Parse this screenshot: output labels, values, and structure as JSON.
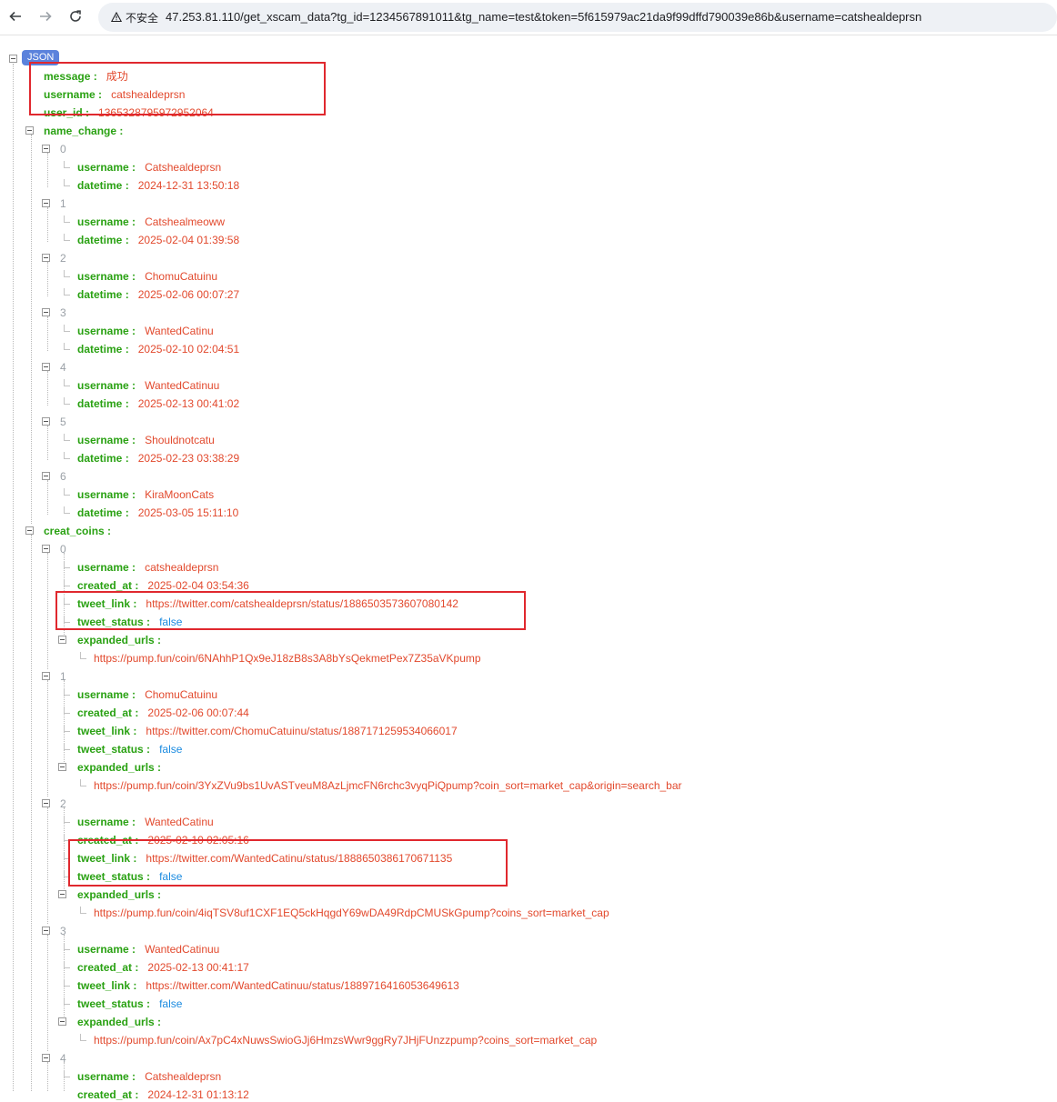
{
  "browser": {
    "security_label": "不安全",
    "url": "47.253.81.110/get_xscam_data?tg_id=1234567891011&tg_name=test&token=5f615979ac21da9f99dffd790039e86b&username=catshealdeprsn"
  },
  "viewer": {
    "badge": "JSON",
    "sep": " :"
  },
  "top": {
    "message_key": "message",
    "message_value": "成功",
    "username_key": "username",
    "username_value": "catshealdeprsn",
    "user_id_key": "user_id",
    "user_id_value": "1365328795972952064"
  },
  "name_change": {
    "key": "name_change",
    "items": [
      {
        "index": "0",
        "username": "Catshealdeprsn",
        "datetime": "2024-12-31 13:50:18"
      },
      {
        "index": "1",
        "username": "Catshealmeoww",
        "datetime": "2025-02-04 01:39:58"
      },
      {
        "index": "2",
        "username": "ChomuCatuinu",
        "datetime": "2025-02-06 00:07:27"
      },
      {
        "index": "3",
        "username": "WantedCatinu",
        "datetime": "2025-02-10 02:04:51"
      },
      {
        "index": "4",
        "username": "WantedCatinuu",
        "datetime": "2025-02-13 00:41:02"
      },
      {
        "index": "5",
        "username": "Shouldnotcatu",
        "datetime": "2025-02-23 03:38:29"
      },
      {
        "index": "6",
        "username": "KiraMoonCats",
        "datetime": "2025-03-05 15:11:10"
      }
    ]
  },
  "keys": {
    "username": "username",
    "datetime": "datetime",
    "created_at": "created_at",
    "tweet_link": "tweet_link",
    "tweet_status": "tweet_status",
    "expanded_urls": "expanded_urls"
  },
  "creat_coins": {
    "key": "creat_coins",
    "items": [
      {
        "index": "0",
        "username": "catshealdeprsn",
        "created_at": "2025-02-04 03:54:36",
        "tweet_link": "https://twitter.com/catshealdeprsn/status/1886503573607080142",
        "tweet_status": "false",
        "expanded_url": "https://pump.fun/coin/6NAhhP1Qx9eJ18zB8s3A8bYsQekmetPex7Z35aVKpump"
      },
      {
        "index": "1",
        "username": "ChomuCatuinu",
        "created_at": "2025-02-06 00:07:44",
        "tweet_link": "https://twitter.com/ChomuCatuinu/status/1887171259534066017",
        "tweet_status": "false",
        "expanded_url": "https://pump.fun/coin/3YxZVu9bs1UvASTveuM8AzLjmcFN6rchc3vyqPiQpump?coin_sort=market_cap&origin=search_bar"
      },
      {
        "index": "2",
        "username": "WantedCatinu",
        "created_at": "2025-02-10 02:05:16",
        "tweet_link": "https://twitter.com/WantedCatinu/status/1888650386170671135",
        "tweet_status": "false",
        "expanded_url": "https://pump.fun/coin/4iqTSV8uf1CXF1EQ5ckHqgdY69wDA49RdpCMUSkGpump?coins_sort=market_cap"
      },
      {
        "index": "3",
        "username": "WantedCatinuu",
        "created_at": "2025-02-13 00:41:17",
        "tweet_link": "https://twitter.com/WantedCatinuu/status/1889716416053649613",
        "tweet_status": "false",
        "expanded_url": "https://pump.fun/coin/Ax7pC4xNuwsSwioGJj6HmzsWwr9ggRy7JHjFUnzzpump?coins_sort=market_cap"
      },
      {
        "index": "4",
        "username": "Catshealdeprsn",
        "created_at": "2024-12-31 01:13:12"
      }
    ]
  },
  "colors": {
    "key": "#29a112",
    "string": "#e2492d",
    "boolean": "#1b8be0",
    "badge": "#5b82dc",
    "highlight": "#e0282e"
  },
  "icons": [
    "back-arrow-icon",
    "forward-arrow-icon",
    "reload-icon",
    "warning-icon",
    "collapse-toggle-icon"
  ]
}
